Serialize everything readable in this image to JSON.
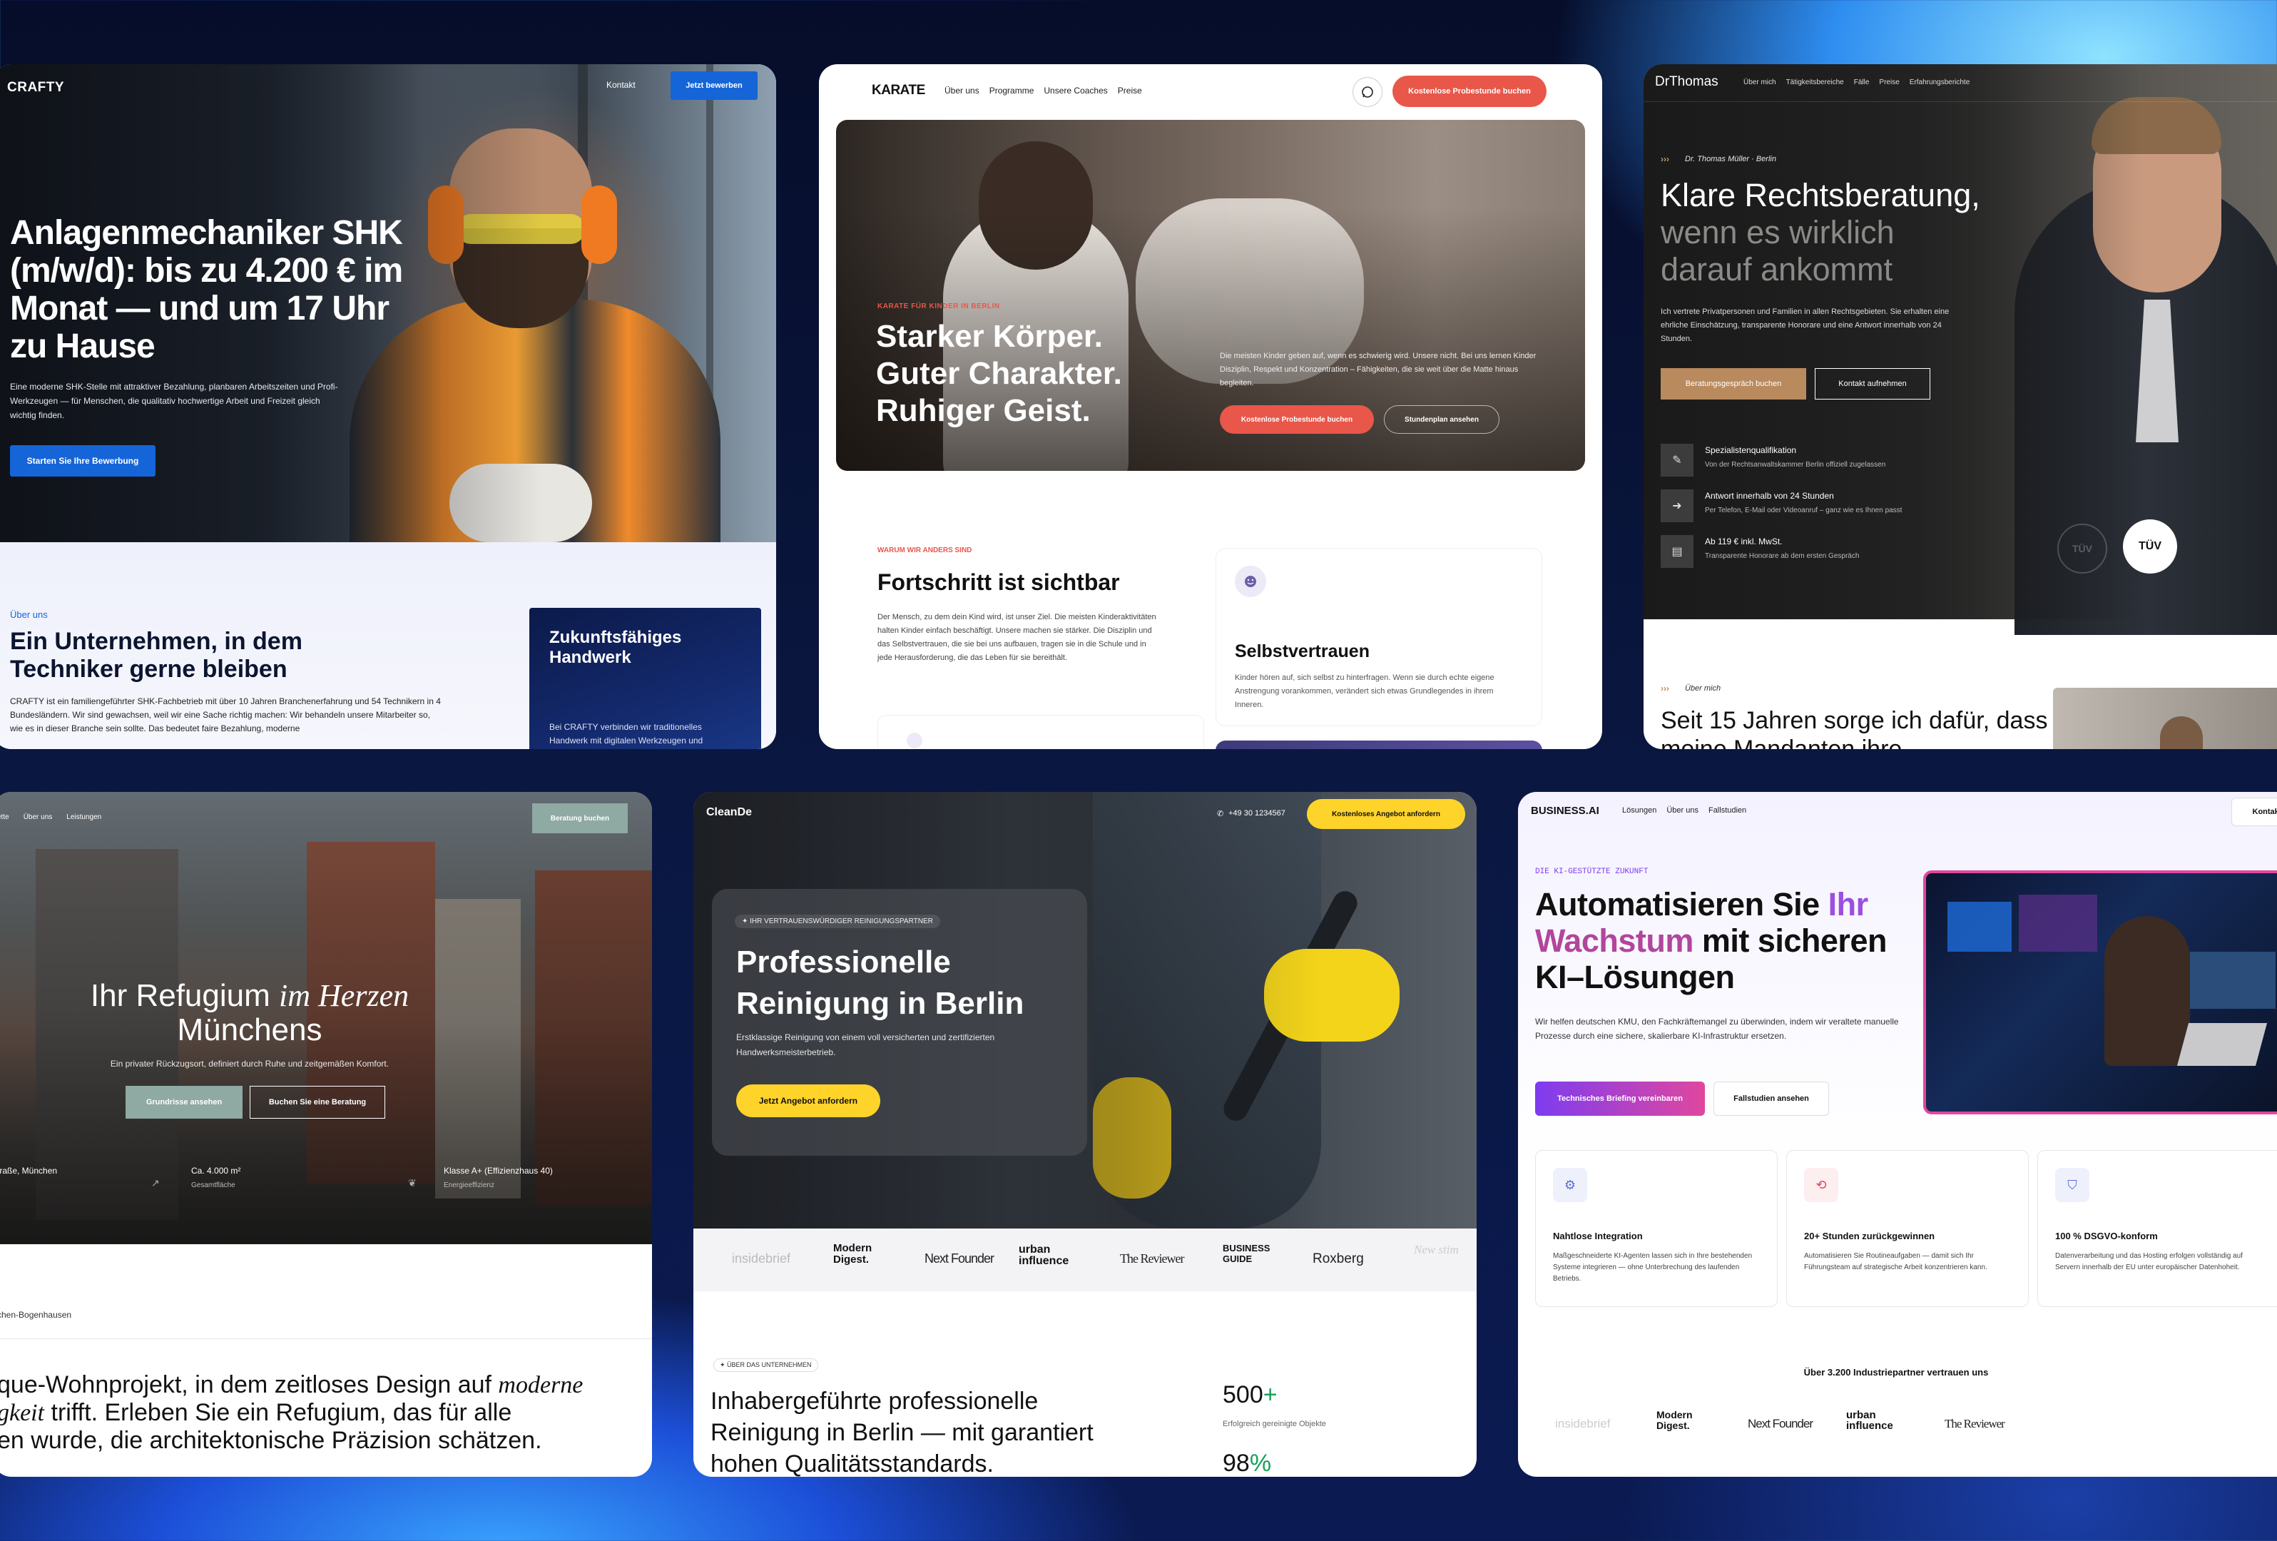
{
  "crafty": {
    "logo": "CRAFTY",
    "nav_kontakt": "Kontakt",
    "nav_cta": "Jetzt bewerben",
    "headline": "Anlagenmechaniker SHK (m/w/d): bis zu 4.200 € im Monat — und um 17 Uhr zu Hause",
    "subtext": "Eine moderne SHK-Stelle mit attraktiver Bezahlung, planbaren Arbeitszeiten und Profi-Werkzeugen — für Menschen, die qualitativ hochwertige Arbeit und Freizeit gleich wichtig finden.",
    "cta": "Starten Sie Ihre Bewerbung",
    "about_label": "Über uns",
    "about_title": "Ein Unternehmen, in dem Techniker gerne bleiben",
    "about_text": "CRAFTY ist ein familiengeführter SHK-Fachbetrieb mit über 10 Jahren Branchenerfahrung und 54 Technikern in 4 Bundesländern. Wir sind gewachsen, weil wir eine Sache richtig machen: Wir behandeln unsere Mitarbeiter so, wie es in dieser Branche sein sollte. Das bedeutet faire Bezahlung, moderne",
    "side_title": "Zukunftsfähiges Handwerk",
    "side_text": "Bei CRAFTY verbinden wir traditionelles Handwerk mit digitalen Werkzeugen und"
  },
  "karate": {
    "logo": "KARATE",
    "nav": [
      "Über uns",
      "Programme",
      "Unsere Coaches",
      "Preise"
    ],
    "nav_cta": "Kostenlose Probestunde buchen",
    "eyebrow": "KARATE FÜR KINDER IN BERLIN",
    "headline": "Starker Körper. Guter Charakter. Ruhiger Geist.",
    "hero_text": "Die meisten Kinder geben auf, wenn es schwierig wird. Unsere nicht. Bei uns lernen Kinder Disziplin, Respekt und Konzentration – Fähigkeiten, die sie weit über die Matte hinaus begleiten.",
    "cta_primary": "Kostenlose Probestunde buchen",
    "cta_secondary": "Stundenplan ansehen",
    "why_label": "WARUM WIR ANDERS SIND",
    "why_title": "Fortschritt ist sichtbar",
    "why_text": "Der Mensch, zu dem dein Kind wird, ist unser Ziel. Die meisten Kinderaktivitäten halten Kinder einfach beschäftigt. Unsere machen sie stärker. Die Disziplin und das Selbstvertrauen, die sie bei uns aufbauen, tragen sie in die Schule und in jede Herausforderung, die das Leben für sie bereithält.",
    "feature_title": "Selbstvertrauen",
    "feature_text": "Kinder hören auf, sich selbst zu hinterfragen. Wenn sie durch echte eigene Anstrengung vorankommen, verändert sich etwas Grundlegendes in ihrem Inneren."
  },
  "drthomas": {
    "logo": "DrThomas",
    "nav": [
      "Über mich",
      "Tätigkeitsbereiche",
      "Fälle",
      "Preise",
      "Erfahrungsberichte"
    ],
    "eyebrow": "Dr. Thomas Müller · Berlin",
    "headline_1": "Klare Rechtsberatung,",
    "headline_2": "wenn es wirklich darauf ankommt",
    "subtext": "Ich vertrete Privatpersonen und Familien in allen Rechtsgebieten. Sie erhalten eine ehrliche Einschätzung, transparente Honorare und eine Antwort innerhalb von 24 Stunden.",
    "cta_primary": "Beratungsgespräch buchen",
    "cta_secondary": "Kontakt aufnehmen",
    "features": [
      {
        "title": "Spezialistenqualifikation",
        "text": "Von der Rechtsanwaltskammer Berlin offiziell zugelassen"
      },
      {
        "title": "Antwort innerhalb von 24 Stunden",
        "text": "Per Telefon, E-Mail oder Videoanruf – ganz wie es Ihnen passt"
      },
      {
        "title": "Ab 119 € inkl. MwSt.",
        "text": "Transparente Honorare ab dem ersten Gespräch"
      }
    ],
    "badge": "TÜV",
    "about_label": "Über mich",
    "about_title": "Seit 15 Jahren sorge ich dafür, dass meine Mandanten ihre"
  },
  "refugium": {
    "nav": [
      "ette",
      "Über uns",
      "Leistungen"
    ],
    "nav_cta": "Beratung buchen",
    "headline_pre": "Ihr Refugium",
    "headline_italic": "im Herzen",
    "headline_post": "Münchens",
    "subtext": "Ein privater Rückzugsort, definiert durch Ruhe und zeitgemäßen Komfort.",
    "cta_primary": "Grundrisse ansehen",
    "cta_secondary": "Buchen Sie eine Beratung",
    "facts": [
      {
        "title": "traße, München",
        "sub": ""
      },
      {
        "title": "Ca. 4.000 m²",
        "sub": "Gesamtfläche"
      },
      {
        "title": "Klasse A+ (Effizienzhaus 40)",
        "sub": "Energieeffizienz"
      }
    ],
    "location": "chen-Bogenhausen",
    "body_1a": "que-Wohnprojekt, in dem zeitloses Design auf ",
    "body_1b": "moderne",
    "body_2a": "gkeit",
    "body_2b": " trifft. Erleben Sie ein Refugium, das für alle",
    "body_3": "en wurde, die architektonische Präzision schätzen."
  },
  "cleande": {
    "logo": "CleanDe",
    "phone": "+49 30 1234567",
    "nav_cta": "Kostenloses Angebot anfordern",
    "eyebrow": "✦ IHR VERTRAUENSWÜRDIGER REINIGUNGSPARTNER",
    "headline": "Professionelle Reinigung in Berlin",
    "subtext": "Erstklassige Reinigung von einem voll versicherten und zertifizierten Handwerksmeisterbetrieb.",
    "cta": "Jetzt Angebot anfordern",
    "logos": [
      "insidebrief",
      "Modern Digest.",
      "Next Founder",
      "urban influence",
      "The Reviewer",
      "BUSINESS GUIDE",
      "Roxberg",
      "New stim"
    ],
    "about_label": "✦ ÜBER DAS UNTERNEHMEN",
    "about_title": "Inhabergeführte professionelle Reinigung in Berlin — mit garantiert hohen Qualitätsstandards.",
    "stat1_value": "500",
    "stat1_suffix": "+",
    "stat1_label": "Erfolgreich gereinigte Objekte",
    "stat2_value": "98",
    "stat2_suffix": "%"
  },
  "businessai": {
    "logo": "BUSINESS.AI",
    "nav": [
      "Lösungen",
      "Über uns",
      "Fallstudien"
    ],
    "nav_cta": "Kontakt",
    "eyebrow": "DIE KI-GESTÜTZTE ZUKUNFT",
    "headline_1": "Automatisieren Sie ",
    "headline_2": "Ihr",
    "headline_3": "Wachstum",
    "headline_4": " mit sicheren KI–Lösungen",
    "subtext": "Wir helfen deutschen KMU, den Fachkräftemangel zu überwinden, indem wir veraltete manuelle Prozesse durch eine sichere, skalierbare KI-Infrastruktur ersetzen.",
    "cta_primary": "Technisches Briefing vereinbaren",
    "cta_secondary": "Fallstudien ansehen",
    "features": [
      {
        "title": "Nahtlose Integration",
        "text": "Maßgeschneiderte KI-Agenten lassen sich in Ihre bestehenden Systeme integrieren — ohne Unterbrechung des laufenden Betriebs."
      },
      {
        "title": "20+ Stunden zurückgewinnen",
        "text": "Automatisieren Sie Routineaufgaben — damit sich Ihr Führungsteam auf strategische Arbeit konzentrieren kann."
      },
      {
        "title": "100 % DSGVO-konform",
        "text": "Datenverarbeitung und das Hosting erfolgen vollständig auf Servern innerhalb der EU unter europäischer Datenhoheit."
      }
    ],
    "trust": "Über 3.200 Industriepartner vertrauen uns",
    "logos": [
      "insidebrief",
      "Modern Digest.",
      "Next Founder",
      "urban influence",
      "The Reviewer"
    ]
  },
  "colors": {
    "crafty_blue": "#1565d8",
    "karate_red": "#e8574a",
    "thomas_gold": "#b98a5e",
    "clean_yellow": "#ffd42a",
    "ai_purple": "#7d3cf0",
    "ai_pink": "#e0479e"
  }
}
